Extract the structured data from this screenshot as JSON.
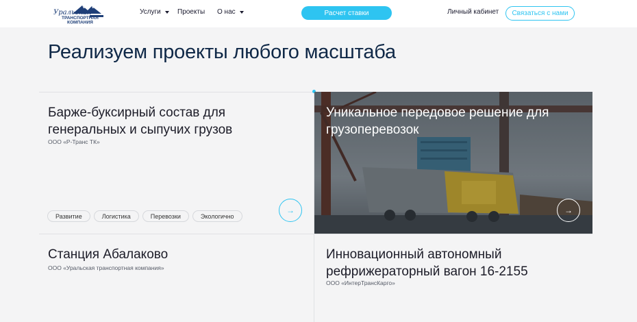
{
  "header": {
    "logo_text": "Уральская транспортная компания",
    "nav": [
      {
        "label": "Услуги",
        "has_dropdown": true
      },
      {
        "label": "Проекты",
        "has_dropdown": false
      },
      {
        "label": "О нас",
        "has_dropdown": true
      }
    ],
    "calc_button": "Расчет ставки",
    "cabinet_link": "Личный кабинет",
    "contact_button": "Связаться с нами"
  },
  "main": {
    "title": "Реализуем проекты любого масштаба",
    "cards": [
      {
        "title_line1": "Барже-буксирный состав для",
        "title_line2": "генеральных и сыпучих грузов",
        "company": "ООО «Р-Транс ТК»",
        "tags": [
          "Развитие",
          "Логистика",
          "Перевозки",
          "Экологично"
        ]
      },
      {
        "title_line1": "Уникальное передовое решение для",
        "title_line2": "грузоперевозок",
        "has_image": true
      },
      {
        "title_line1": "Станция Абалаково",
        "company": "ООО «Уральская транспортная компания»"
      },
      {
        "title_line1": "Инновационный автономный",
        "title_line2": "рефрижераторный вагон 16-2155",
        "company": "ООО «ИнтерТрансКарго»"
      }
    ]
  },
  "icons": {
    "arrow": "→",
    "caret": "caret-down"
  },
  "colors": {
    "accent": "#2ec4f1",
    "title": "#0f2847",
    "background": "#f4f4f5"
  }
}
